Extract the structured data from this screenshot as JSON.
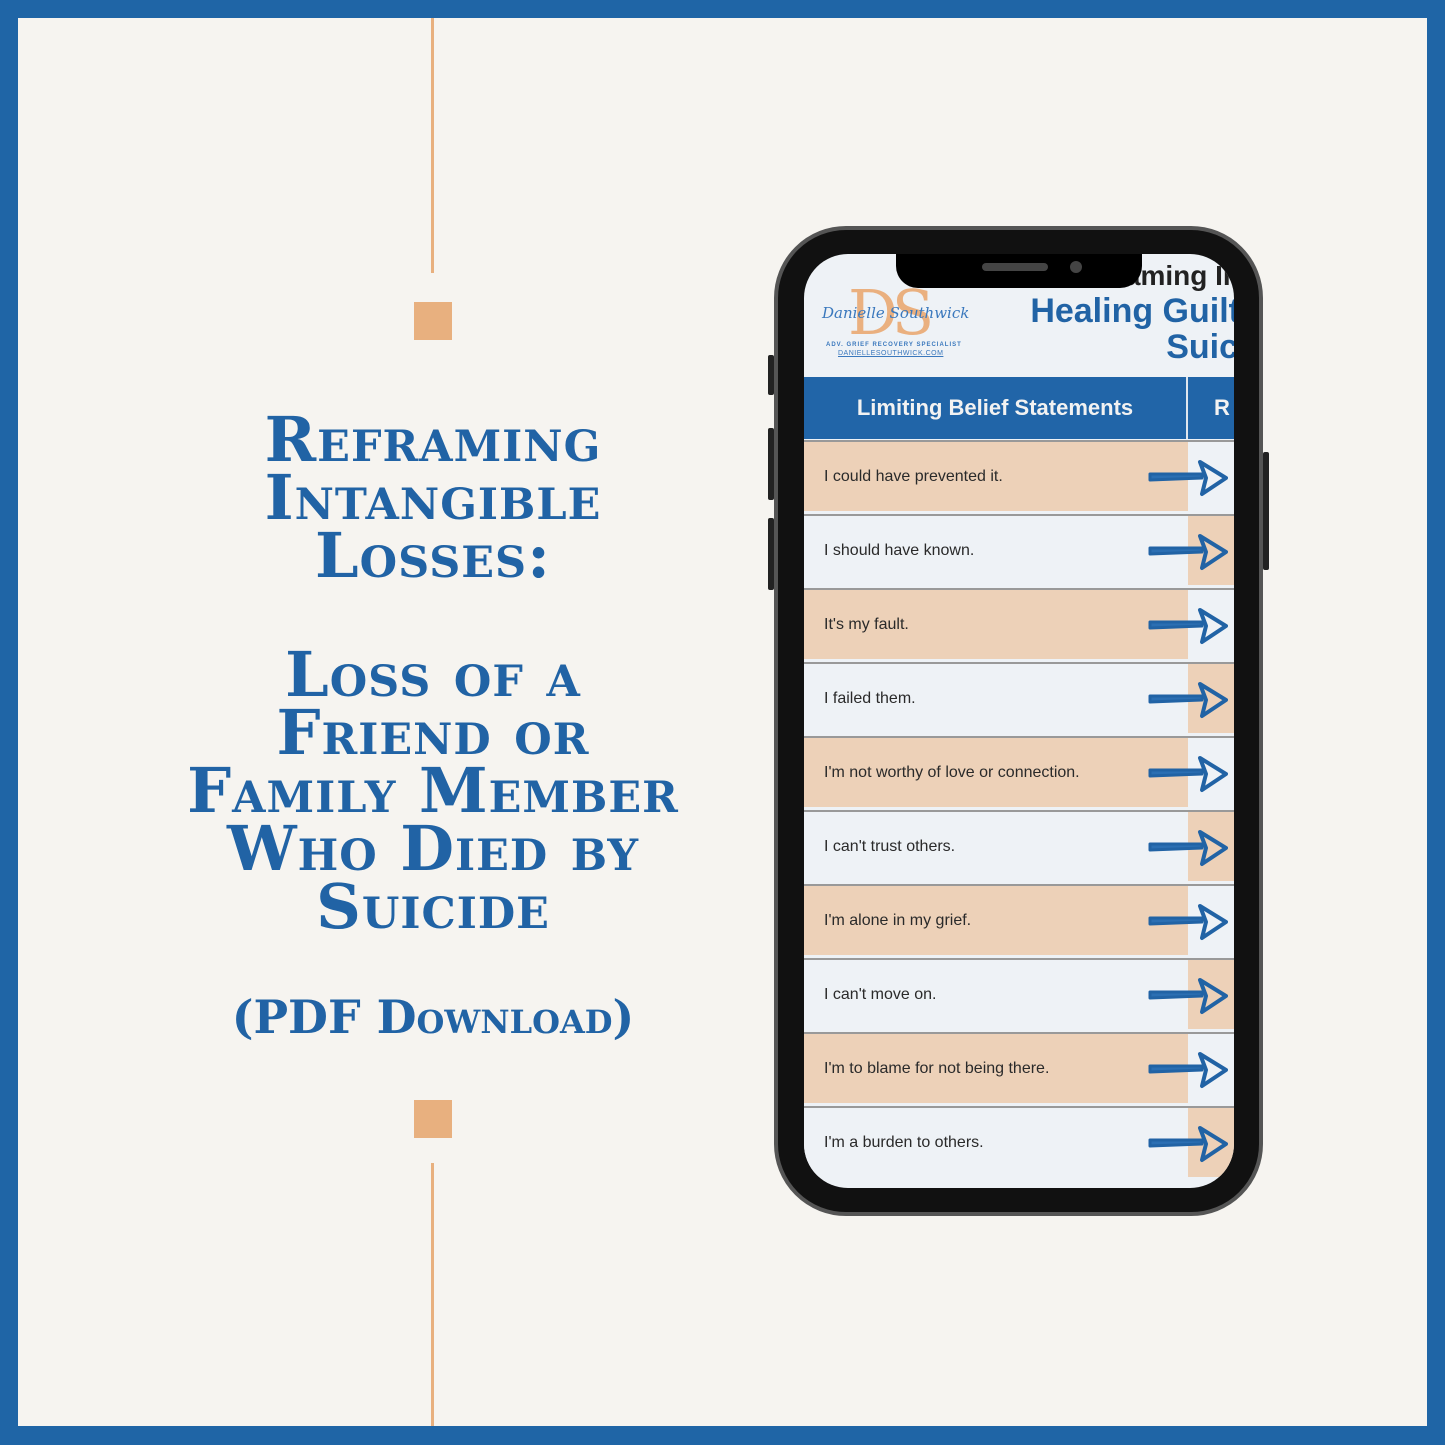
{
  "title_lines": [
    "Reframing",
    "Intangible",
    "Losses:"
  ],
  "subtitle_lines": [
    "Loss of a",
    "Friend or",
    "Family Member",
    "Who Died by",
    "Suicide"
  ],
  "download_label": "(PDF Download)",
  "colors": {
    "border": "#1f65a6",
    "accent": "#e8b07f",
    "title": "#2163a5",
    "row_peach": "#edd1b8",
    "row_light": "#eef2f6"
  },
  "document": {
    "logo": {
      "monogram": "DS",
      "signature": "Danielle Southwick",
      "tagline": "ADV. GRIEF RECOVERY SPECIALIST",
      "url": "DANIELLESOUTHWICK.COM"
    },
    "heading_line1": "aming In",
    "heading_line2": "Healing Guilt",
    "heading_line3": "Suic",
    "table": {
      "col1_header": "Limiting Belief Statements",
      "col2_header": "R",
      "rows": [
        "I could have prevented it.",
        "I should have known.",
        "It's my fault.",
        "I failed them.",
        "I'm not worthy of love or connection.",
        "I can't trust others.",
        "I'm alone in my grief.",
        "I can't move on.",
        "I'm to blame for not being there.",
        "I'm a burden to others."
      ],
      "row_icon": "arrow-right-icon"
    }
  }
}
